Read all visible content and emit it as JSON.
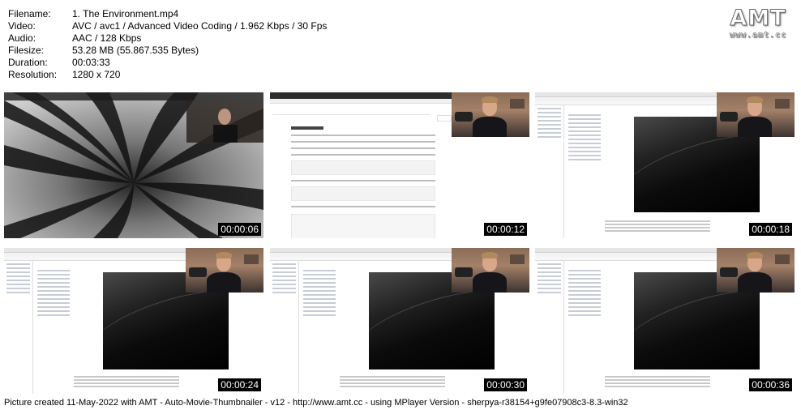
{
  "info": {
    "rows": [
      {
        "key": "Filename:",
        "value": "1. The Environment.mp4"
      },
      {
        "key": "Video:",
        "value": "AVC / avc1 / Advanced Video Coding / 1.962 Kbps / 30 Fps"
      },
      {
        "key": "Audio:",
        "value": "AAC / 128 Kbps"
      },
      {
        "key": "Filesize:",
        "value": "53.28 MB (55.867.535 Bytes)"
      },
      {
        "key": "Duration:",
        "value": "00:03:33"
      },
      {
        "key": "Resolution:",
        "value": "1280 x 720"
      }
    ]
  },
  "logo": {
    "mark": "AMT",
    "site": "www.amt.cc"
  },
  "thumbnails": [
    {
      "timestamp": "00:00:06"
    },
    {
      "timestamp": "00:00:12"
    },
    {
      "timestamp": "00:00:18"
    },
    {
      "timestamp": "00:00:24"
    },
    {
      "timestamp": "00:00:30"
    },
    {
      "timestamp": "00:00:36"
    }
  ],
  "footer": {
    "text": "Picture created 11-May-2022 with AMT - Auto-Movie-Thumbnailer - v12 - http://www.amt.cc - using MPlayer Version - sherpya-r38154+g9fe07908c3-8.3-win32"
  }
}
